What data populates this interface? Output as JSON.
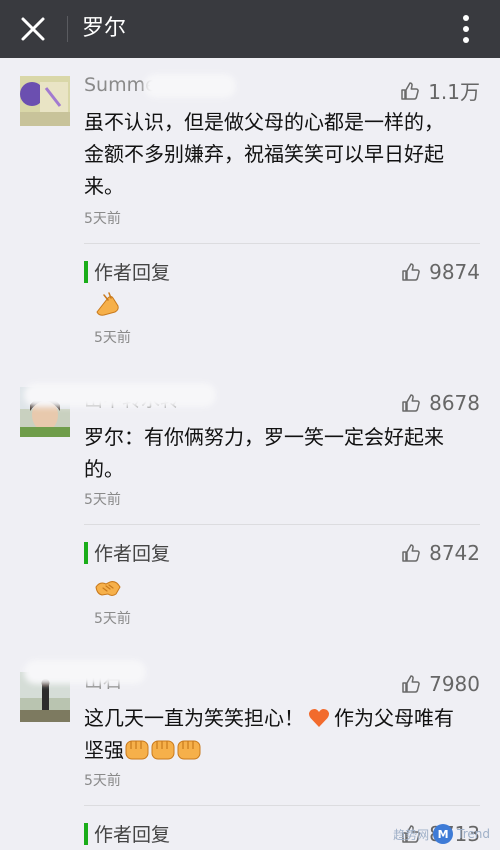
{
  "header": {
    "title": "罗尔",
    "close_icon": "close-icon",
    "more_icon": "more-vertical-icon"
  },
  "comments": [
    {
      "name": "Summer",
      "likes": "1.1万",
      "text": "虽不认识，但是做父母的心都是一样的，金额不多别嫌弃，祝福笑笑可以早日好起来。",
      "time": "5天前",
      "reply": {
        "label": "作者回复",
        "likes": "9874",
        "emoji": "raised-hand-emoji",
        "time": "5天前"
      }
    },
    {
      "name": "山不转水转",
      "likes": "8678",
      "text": "罗尔：有你俩努力，罗一笑一定会好起来的。",
      "time": "5天前",
      "reply": {
        "label": "作者回复",
        "likes": "8742",
        "emoji": "handshake-emoji",
        "time": "5天前"
      }
    },
    {
      "name": "山石",
      "likes": "7980",
      "text_before": "这几天一直为笑笑担心！",
      "text_after": "作为父母唯有坚强",
      "time": "5天前",
      "reply": {
        "label": "作者回复",
        "likes": "8713"
      }
    }
  ],
  "watermark": {
    "prefix": "趋势网",
    "badge": "M",
    "suffix": "Trend"
  },
  "colors": {
    "topbar": "#393a3f",
    "background": "#efeff4",
    "reply_accent": "#1aad19"
  }
}
